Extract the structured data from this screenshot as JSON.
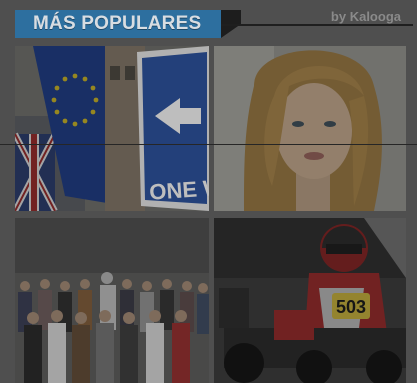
{
  "header": {
    "title": "MÁS POPULARES",
    "by_label": "by Kalooga",
    "accent_color": "#2d6f9f"
  },
  "tiles": [
    {
      "name": "eu-flag-sign",
      "sign_text": "ONE WA"
    },
    {
      "name": "blonde-woman-portrait"
    },
    {
      "name": "group-photo"
    },
    {
      "name": "kart-racer",
      "kart_number": "503"
    }
  ]
}
